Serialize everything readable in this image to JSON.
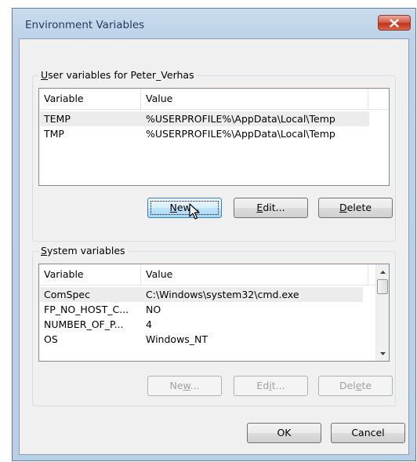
{
  "window": {
    "title": "Environment Variables"
  },
  "user_vars": {
    "group_label_key": "U",
    "group_label_rest": "ser variables for Peter_Verhas",
    "columns": [
      "Variable",
      "Value"
    ],
    "rows": [
      {
        "name": "TEMP",
        "value": "%USERPROFILE%\\AppData\\Local\\Temp",
        "selected": true
      },
      {
        "name": "TMP",
        "value": "%USERPROFILE%\\AppData\\Local\\Temp",
        "selected": false
      }
    ],
    "buttons": {
      "new_key": "N",
      "new_rest": "ew...",
      "edit_key": "E",
      "edit_rest": "dit...",
      "delete_pre": "",
      "delete_key": "D",
      "delete_rest": "elete"
    }
  },
  "system_vars": {
    "group_label_key": "S",
    "group_label_rest": "ystem variables",
    "columns": [
      "Variable",
      "Value"
    ],
    "rows": [
      {
        "name": "ComSpec",
        "value": "C:\\Windows\\system32\\cmd.exe",
        "selected": true
      },
      {
        "name": "FP_NO_HOST_C...",
        "value": "NO",
        "selected": false
      },
      {
        "name": "NUMBER_OF_P...",
        "value": "4",
        "selected": false
      },
      {
        "name": "OS",
        "value": "Windows_NT",
        "selected": false
      }
    ],
    "buttons": {
      "new_pre": "Ne",
      "new_key": "w",
      "new_rest": "...",
      "edit_pre": "Ed",
      "edit_key": "i",
      "edit_rest": "t...",
      "delete_pre": "Del",
      "delete_key": "e",
      "delete_rest": "te"
    }
  },
  "dialog_buttons": {
    "ok": "OK",
    "cancel": "Cancel"
  }
}
